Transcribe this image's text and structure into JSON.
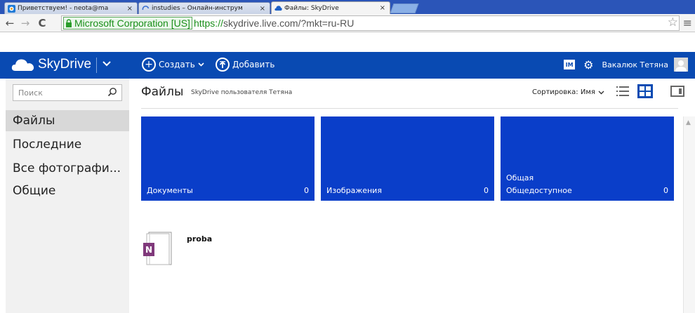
{
  "browser": {
    "tabs": [
      {
        "title": "Приветствуем! - neota@ma",
        "icon": "mail-icon"
      },
      {
        "title": "instudies – Онлайн-инструм",
        "icon": "loading-spinner-icon"
      },
      {
        "title": "Файлы: SkyDrive",
        "icon": "skydrive-cloud-icon"
      }
    ],
    "close_glyph": "×",
    "ev_label": "Microsoft Corporation [US]",
    "url_scheme": "https://",
    "url_rest": "skydrive.live.com/?mkt=ru-RU"
  },
  "header": {
    "brand": "SkyDrive",
    "create_label": "Создать",
    "add_label": "Добавить",
    "messenger_glyph": "IM",
    "user_name": "Вакалюк Тетяна"
  },
  "sidebar": {
    "search_placeholder": "Поиск",
    "items": [
      {
        "label": "Файлы",
        "selected": true
      },
      {
        "label": "Последние",
        "selected": false
      },
      {
        "label": "Все фотографи...",
        "selected": false
      },
      {
        "label": "Общие",
        "selected": false
      }
    ]
  },
  "main": {
    "title": "Файлы",
    "subtitle": "SkyDrive пользователя Тетяна",
    "sort_label": "Сортировка: Имя",
    "tiles": [
      {
        "name": "Документы",
        "count": "0"
      },
      {
        "name": "Изображения",
        "count": "0"
      },
      {
        "name_line1": "Общая",
        "name": "Общедоступное",
        "count": "0"
      }
    ],
    "file": {
      "name": "proba",
      "badge": "N"
    }
  },
  "colors": {
    "appbar": "#094ab2",
    "tile": "#0a3ec9",
    "onenote": "#80397b"
  }
}
